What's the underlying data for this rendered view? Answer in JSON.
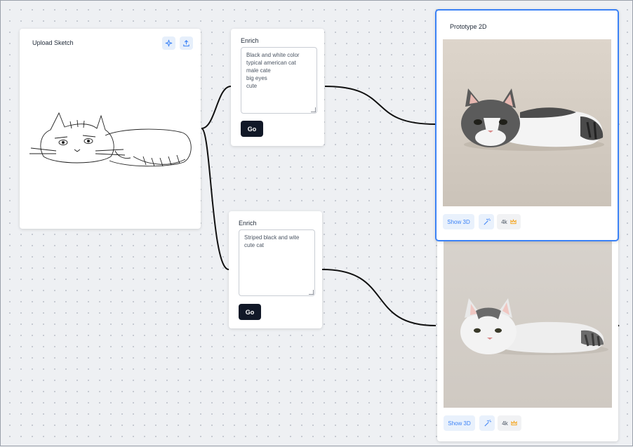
{
  "upload": {
    "title": "Upload Sketch",
    "icons": [
      "sparkle-icon",
      "upload-icon"
    ]
  },
  "enrich_top": {
    "title": "Enrich",
    "text": "Black and white color\ntypical american cat\nmale cate\nbig eyes\ncute",
    "go_label": "Go"
  },
  "enrich_bottom": {
    "title": "Enrich",
    "text": "Striped black and wite\ncute cat",
    "go_label": "Go"
  },
  "prototype_top": {
    "title": "Prototype 2D",
    "show3d": "Show 3D",
    "magic_icon": "magic-wand-icon",
    "res_label": "4k",
    "crown_icon": "crown-icon"
  },
  "prototype_bottom": {
    "show3d": "Show 3D",
    "magic_icon": "magic-wand-icon",
    "res_label": "4k",
    "crown_icon": "crown-icon"
  },
  "colors": {
    "accent": "#3b82f6",
    "selected_border": "#3b82f6",
    "button_dark": "#111827",
    "crown": "#f59e0b"
  }
}
